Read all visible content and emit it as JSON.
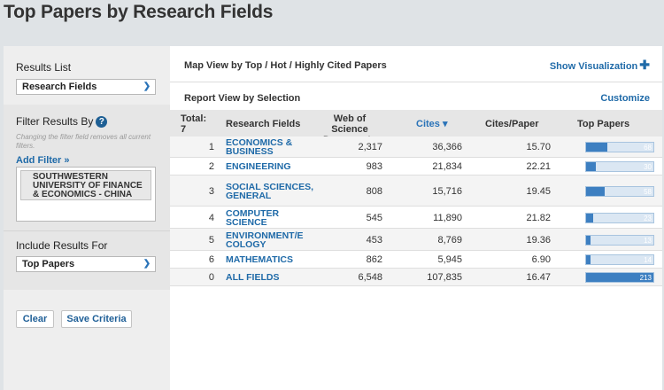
{
  "page": {
    "title": "Top Papers by Research Fields"
  },
  "sidebar": {
    "results_list_label": "Results List",
    "results_list_value": "Research Fields",
    "filter_label": "Filter Results By",
    "filter_help_icon": "help-icon",
    "filter_hint": "Changing the filter field removes all current filters.",
    "add_filter": "Add Filter »",
    "filter_value": "SOUTHWESTERN UNIVERSITY OF FINANCE & ECONOMICS - CHINA",
    "include_label": "Include Results For",
    "include_value": "Top Papers",
    "clear_button": "Clear",
    "save_button": "Save Criteria"
  },
  "main": {
    "map_view_text": "Map View by Top / Hot / Highly Cited Papers",
    "show_visualization": "Show Visualization",
    "report_view_text": "Report View by Selection",
    "customize": "Customize",
    "table": {
      "headers": {
        "total": "Total: 7",
        "field": "Research Fields",
        "wos": "Web of Science Documents",
        "cites": "Cites ▾",
        "cites_per_paper": "Cites/Paper",
        "top_papers": "Top Papers"
      },
      "rows": [
        {
          "rank": "1",
          "field": "ECONOMICS & BUSINESS",
          "wos": "2,317",
          "cites": "36,366",
          "cpp": "15.70",
          "top": "68",
          "top_value": 68
        },
        {
          "rank": "2",
          "field": "ENGINEERING",
          "wos": "983",
          "cites": "21,834",
          "cpp": "22.21",
          "top": "30",
          "top_value": 30
        },
        {
          "rank": "3",
          "field": "SOCIAL SCIENCES, GENERAL",
          "wos": "808",
          "cites": "15,716",
          "cpp": "19.45",
          "top": "58",
          "top_value": 58
        },
        {
          "rank": "4",
          "field": "COMPUTER SCIENCE",
          "wos": "545",
          "cites": "11,890",
          "cpp": "21.82",
          "top": "23",
          "top_value": 23
        },
        {
          "rank": "5",
          "field": "ENVIRONMENT/E COLOGY",
          "wos": "453",
          "cites": "8,769",
          "cpp": "19.36",
          "top": "13",
          "top_value": 13
        },
        {
          "rank": "6",
          "field": "MATHEMATICS",
          "wos": "862",
          "cites": "5,945",
          "cpp": "6.90",
          "top": "14",
          "top_value": 14
        },
        {
          "rank": "0",
          "field": "ALL FIELDS",
          "wos": "6,548",
          "cites": "107,835",
          "cpp": "16.47",
          "top": "213",
          "top_value": 213
        }
      ],
      "top_max": 213
    }
  },
  "colors": {
    "link": "#1f6aa8",
    "bar": "#3d7fc1",
    "bar_track": "#dbe7f3"
  }
}
